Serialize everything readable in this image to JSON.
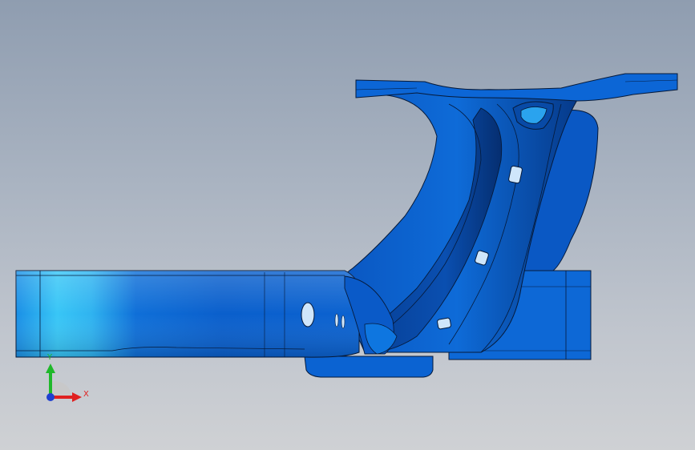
{
  "viewport": {
    "background_top": "#8f9db0",
    "background_bottom": "#cfd1d4"
  },
  "model": {
    "color_primary": "#0a63d6",
    "color_highlight": "#2bc4f2",
    "color_shadow": "#073a86",
    "edge_color": "#061a3a"
  },
  "triad": {
    "x_label": "X",
    "y_label": "Y",
    "x_color": "#e02020",
    "y_color": "#1fb82a",
    "z_color": "#1f3fd0"
  }
}
